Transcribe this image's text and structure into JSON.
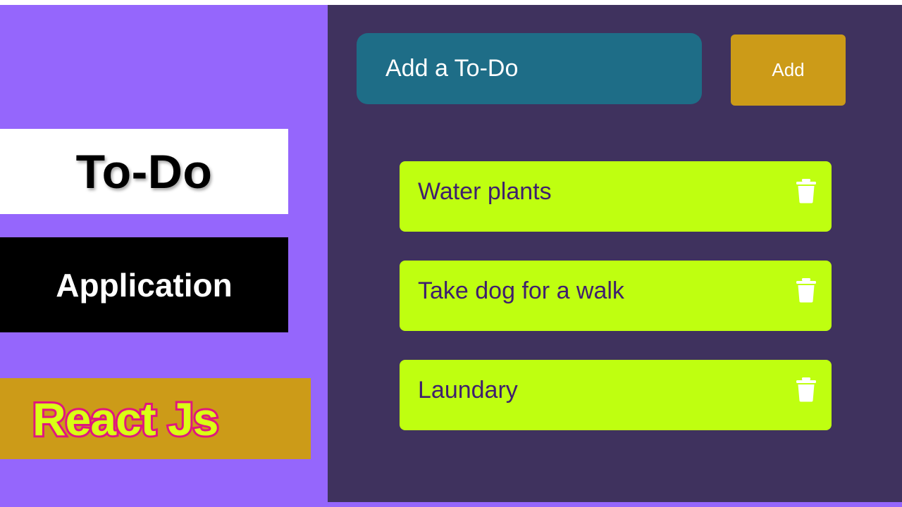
{
  "banners": {
    "title": "To-Do",
    "subtitle": "Application",
    "framework": "React Js"
  },
  "form": {
    "input_placeholder": "Add a To-Do",
    "input_value": "",
    "add_label": "Add"
  },
  "todos": [
    {
      "text": "Water plants",
      "action_icon": "trash-icon"
    },
    {
      "text": "Take dog for a walk",
      "action_icon": "trash-icon"
    },
    {
      "text": "Laundary",
      "action_icon": "trash-icon"
    }
  ],
  "colors": {
    "background": "#9566fc",
    "app_panel": "#3f325e",
    "input_bg": "#1e6d87",
    "accent_gold": "#cc9b18",
    "todo_item_bg": "#bfff10",
    "todo_text": "#3f1f6e",
    "react_fill": "#d9ff14",
    "react_outline": "#e0167f"
  }
}
